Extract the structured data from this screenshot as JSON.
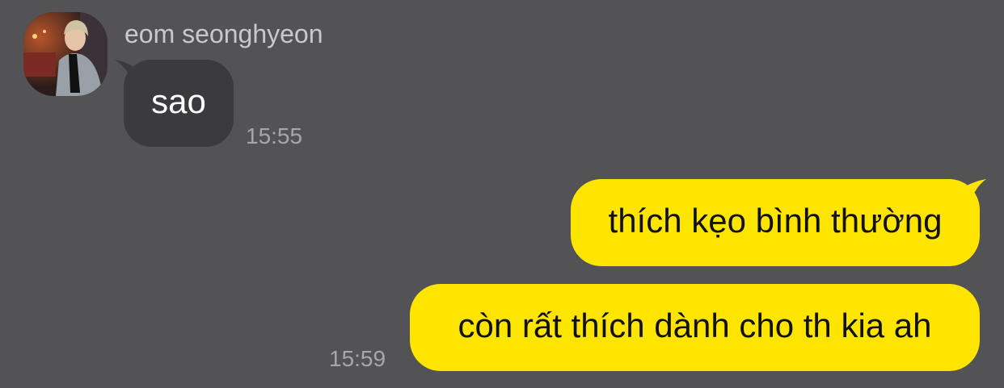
{
  "chat": {
    "incoming": {
      "sender_name": "eom seonghyeon",
      "avatar": "profile-photo",
      "messages": [
        {
          "text": "sao",
          "time": "15:55"
        }
      ]
    },
    "outgoing": {
      "messages": [
        {
          "text": "thích kẹo bình thường"
        },
        {
          "text": "còn rất thích dành cho th kia ah",
          "time": "15:59"
        }
      ]
    }
  },
  "colors": {
    "background": "#535254",
    "incoming_bubble": "#3b3b3d",
    "outgoing_bubble": "#fee500",
    "timestamp": "#a7a6a8"
  }
}
